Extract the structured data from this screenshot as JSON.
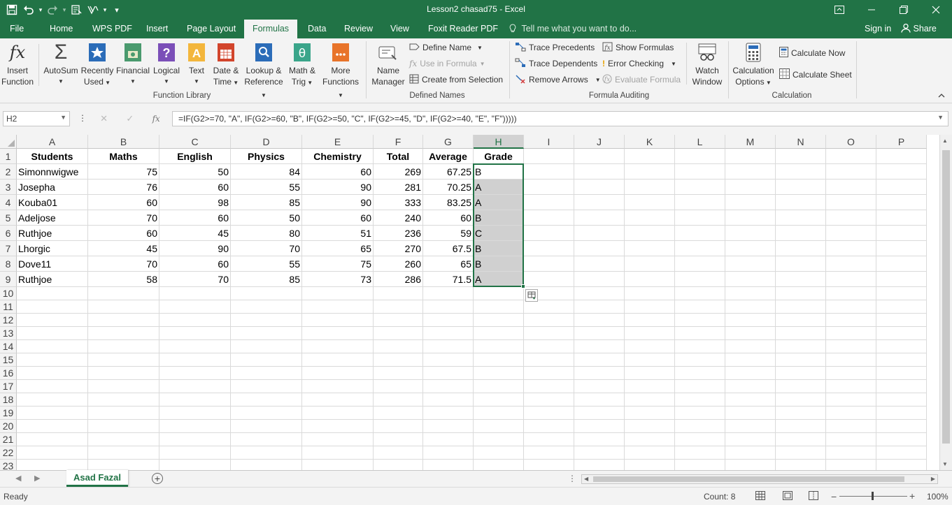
{
  "window": {
    "title": "Lesson2 chasad75 - Excel"
  },
  "qat": {
    "items": [
      "save-icon",
      "undo-icon",
      "redo-icon",
      "touch-mode-icon",
      "format-painter-icon",
      "customize-icon"
    ]
  },
  "tabs": [
    "File",
    "Home",
    "WPS PDF",
    "Insert",
    "Page Layout",
    "Formulas",
    "Data",
    "Review",
    "View",
    "Foxit Reader PDF"
  ],
  "active_tab": "Formulas",
  "tell_me": "Tell me what you want to do...",
  "sign_in": "Sign in",
  "share": "Share",
  "ribbon": {
    "function_library": {
      "label": "Function Library",
      "insert_function": [
        "Insert",
        "Function"
      ],
      "autosum": "AutoSum",
      "recently_used": [
        "Recently",
        "Used"
      ],
      "financial": "Financial",
      "logical": "Logical",
      "text": "Text",
      "date_time": [
        "Date &",
        "Time"
      ],
      "lookup_reference": [
        "Lookup &",
        "Reference"
      ],
      "math_trig": [
        "Math &",
        "Trig"
      ],
      "more_functions": [
        "More",
        "Functions"
      ]
    },
    "defined_names": {
      "label": "Defined Names",
      "name_manager": [
        "Name",
        "Manager"
      ],
      "define_name": "Define Name",
      "use_in_formula": "Use in Formula",
      "create_from_selection": "Create from Selection"
    },
    "formula_auditing": {
      "label": "Formula Auditing",
      "trace_precedents": "Trace Precedents",
      "trace_dependents": "Trace Dependents",
      "remove_arrows": "Remove Arrows",
      "show_formulas": "Show Formulas",
      "error_checking": "Error Checking",
      "evaluate_formula": "Evaluate Formula",
      "watch_window": [
        "Watch",
        "Window"
      ]
    },
    "calculation": {
      "label": "Calculation",
      "calculation_options": [
        "Calculation",
        "Options"
      ],
      "calculate_now": "Calculate Now",
      "calculate_sheet": "Calculate Sheet"
    }
  },
  "formula_bar": {
    "name_box": "H2",
    "formula": "=IF(G2>=70, \"A\", IF(G2>=60, \"B\", IF(G2>=50, \"C\", IF(G2>=45, \"D\", IF(G2>=40, \"E\", \"F\")))))",
    "fx": "fx"
  },
  "grid": {
    "columns": [
      "A",
      "B",
      "C",
      "D",
      "E",
      "F",
      "G",
      "H",
      "I",
      "J",
      "K",
      "L",
      "M",
      "N",
      "O",
      "P"
    ],
    "row_numbers": [
      "1",
      "2",
      "3",
      "4",
      "5",
      "6",
      "7",
      "8",
      "9",
      "10",
      "11",
      "12",
      "13",
      "14",
      "15",
      "16",
      "17",
      "18",
      "19",
      "20",
      "21",
      "22",
      "23"
    ],
    "selected_column": "H",
    "headers": [
      "Students",
      "Maths",
      "English",
      "Physics",
      "Chemistry",
      "Total",
      "Average",
      "Grade"
    ],
    "rows": [
      [
        "Simonnwigwe",
        "75",
        "50",
        "84",
        "60",
        "269",
        "67.25",
        "B"
      ],
      [
        "Josepha",
        "76",
        "60",
        "55",
        "90",
        "281",
        "70.25",
        "A"
      ],
      [
        "Kouba01",
        "60",
        "98",
        "85",
        "90",
        "333",
        "83.25",
        "A"
      ],
      [
        "Adeljose",
        "70",
        "60",
        "50",
        "60",
        "240",
        "60",
        "B"
      ],
      [
        "Ruthjoe",
        "60",
        "45",
        "80",
        "51",
        "236",
        "59",
        "C"
      ],
      [
        "Lhorgic",
        "45",
        "90",
        "70",
        "65",
        "270",
        "67.5",
        "B"
      ],
      [
        "Dove11",
        "70",
        "60",
        "55",
        "75",
        "260",
        "65",
        "B"
      ],
      [
        "Ruthjoe",
        "58",
        "70",
        "85",
        "73",
        "286",
        "71.5",
        "A"
      ]
    ]
  },
  "sheet_tab": "Asad Fazal",
  "status": {
    "ready": "Ready",
    "count": "Count: 8",
    "zoom": "100%"
  },
  "colors": {
    "accent": "#217346",
    "selection": "#d0d0d0"
  }
}
